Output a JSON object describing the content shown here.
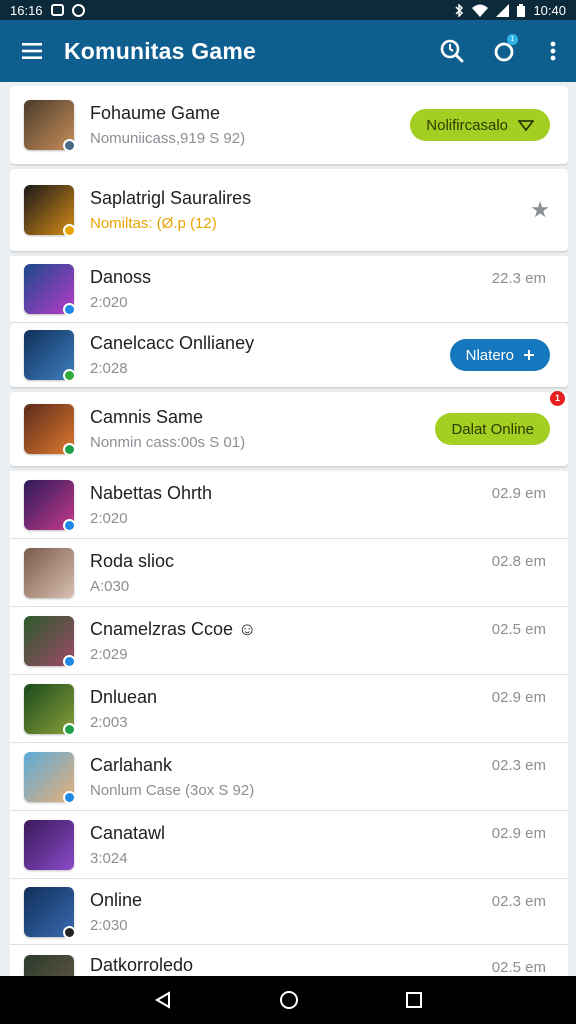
{
  "status_bar": {
    "time_left": "16:16",
    "time_right": "10:40"
  },
  "app_bar": {
    "title": "Komunitas Game",
    "notification_count": "1"
  },
  "items": [
    {
      "title": "Fohaume Game",
      "subtitle": "Nomuniicass,919 S 92)",
      "action": "Nolifircasalo",
      "action_icon": "chevron-down-icon",
      "colors": [
        "#4a3a2a",
        "#c88f5a"
      ],
      "badge": "#4a6a8a"
    },
    {
      "title": "Saplatrigl Sauralires",
      "subtitle": "Nomiltas: (Ø.p (12)",
      "subtitle_style": "gold",
      "star": "★",
      "colors": [
        "#1a1a1a",
        "#d58a17"
      ],
      "badge": "#e8a400"
    },
    {
      "title": "Danoss",
      "subtitle": "2:020",
      "time": "22.3 em",
      "colors": [
        "#1a4a8a",
        "#b83acb"
      ],
      "badge": "#1e88e5"
    },
    {
      "title": "Canelcacc Onllianey",
      "subtitle": "2:028",
      "action": "Nlatero",
      "action_icon": "plus-icon",
      "action_style": "blue",
      "colors": [
        "#0f2f5a",
        "#3f7fbf"
      ],
      "badge": "#2eaa3a"
    },
    {
      "title": "Camnis Same",
      "subtitle": "Nonmin cass:00s S 01)",
      "action": "Dalat Online",
      "notification": "1",
      "colors": [
        "#5a2a1a",
        "#e07a30"
      ],
      "badge": "#1ea04a"
    },
    {
      "title": "Nabettas Ohrth",
      "subtitle": "2:020",
      "time": "02.9 em",
      "colors": [
        "#2a1a5a",
        "#c83a8a"
      ],
      "badge": "#1e88e5"
    },
    {
      "title": "Roda slioc",
      "subtitle": "A:030",
      "time": "02.8 em",
      "colors": [
        "#7a5a4a",
        "#d8c0b0"
      ],
      "badge": ""
    },
    {
      "title": "Cnamelzras Ccoe ☺",
      "subtitle": "2:029",
      "time": "02.5 em",
      "colors": [
        "#2a5a2a",
        "#a04a6a"
      ],
      "badge": "#1e88e5"
    },
    {
      "title": "Dnluean",
      "subtitle": "2:003",
      "time": "02.9 em",
      "colors": [
        "#1a4a1a",
        "#8aa03a"
      ],
      "badge": "#1ea04a"
    },
    {
      "title": "Carlahank",
      "subtitle": "Nonlum Case (3ox S 92)",
      "time": "02.3 em",
      "colors": [
        "#5aaad8",
        "#e8b07a"
      ],
      "badge": "#1e88e5"
    },
    {
      "title": "Canatawl",
      "subtitle": "3:024",
      "time": "02.9 em",
      "colors": [
        "#3a1a5a",
        "#8a4ac8"
      ],
      "badge": ""
    },
    {
      "title": "Online",
      "subtitle": "2:030",
      "time": "02.3 em",
      "colors": [
        "#0f2f5a",
        "#3a6ab0"
      ],
      "badge": "#222222"
    },
    {
      "title": "Datkorroledo",
      "subtitle": "",
      "time": "02.5 em",
      "colors": [
        "#2a3a2a",
        "#6a5a4a"
      ],
      "badge": ""
    }
  ]
}
